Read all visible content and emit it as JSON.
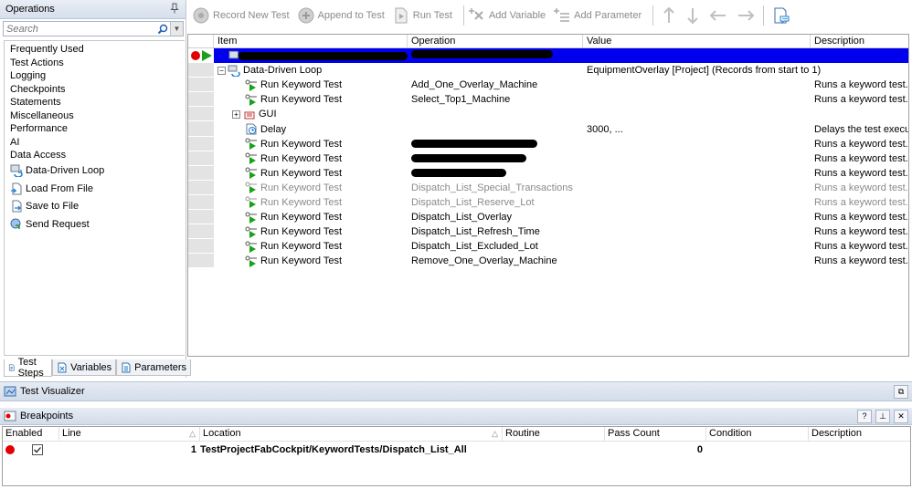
{
  "operations_panel": {
    "title": "Operations",
    "search_placeholder": "Search",
    "items": [
      "Frequently Used",
      "Test Actions",
      "Logging",
      "Checkpoints",
      "Statements",
      "Miscellaneous",
      "Performance",
      "AI",
      "Data Access"
    ],
    "icon_items": [
      {
        "label": "Data-Driven Loop",
        "icon": "loop-icon"
      },
      {
        "label": "Load From File",
        "icon": "load-file-icon"
      },
      {
        "label": "Save to File",
        "icon": "save-file-icon"
      },
      {
        "label": "Send Request",
        "icon": "send-request-icon"
      }
    ],
    "tabs": [
      "Test Steps",
      "Variables",
      "Parameters"
    ]
  },
  "toolbar": {
    "record_new_test": "Record New Test",
    "append_to_test": "Append to Test",
    "run_test": "Run Test",
    "add_variable": "Add Variable",
    "add_parameter": "Add Parameter"
  },
  "grid": {
    "columns": [
      "Item",
      "Operation",
      "Value",
      "Description"
    ],
    "rows": [
      {
        "item": "",
        "operation": "",
        "value": "",
        "description": "",
        "selected": true,
        "redacted_item": true
      },
      {
        "item": "Data-Driven Loop",
        "operation": "",
        "value": "EquipmentOverlay [Project] (Records from start to 1)",
        "description": ""
      },
      {
        "item": "Run Keyword Test",
        "operation": "Add_One_Overlay_Machine",
        "value": "",
        "description": "Runs a keyword test."
      },
      {
        "item": "Run Keyword Test",
        "operation": "Select_Top1_Machine",
        "value": "",
        "description": "Runs a keyword test."
      },
      {
        "item": "GUI",
        "operation": "",
        "value": "",
        "description": ""
      },
      {
        "item": "Delay",
        "operation": "",
        "value": "3000, ...",
        "description": "Delays the test execut..."
      },
      {
        "item": "Run Keyword Test",
        "operation": "",
        "value": "",
        "description": "Runs a keyword test.",
        "redacted_op": 138
      },
      {
        "item": "Run Keyword Test",
        "operation": "",
        "value": "",
        "description": "Runs a keyword test.",
        "redacted_op": 126
      },
      {
        "item": "Run Keyword Test",
        "operation": "",
        "value": "",
        "description": "Runs a keyword test.",
        "redacted_op": 104
      },
      {
        "item": "Run Keyword Test",
        "operation": "Dispatch_List_Special_Transactions",
        "value": "",
        "description": "Runs a keyword test.",
        "disabled": true
      },
      {
        "item": "Run Keyword Test",
        "operation": "Dispatch_List_Reserve_Lot",
        "value": "",
        "description": "Runs a keyword test.",
        "disabled": true
      },
      {
        "item": "Run Keyword Test",
        "operation": "Dispatch_List_Overlay",
        "value": "",
        "description": "Runs a keyword test."
      },
      {
        "item": "Run Keyword Test",
        "operation": "Dispatch_List_Refresh_Time",
        "value": "",
        "description": "Runs a keyword test."
      },
      {
        "item": "Run Keyword Test",
        "operation": "Dispatch_List_Excluded_Lot",
        "value": "",
        "description": "Runs a keyword test."
      },
      {
        "item": "Run Keyword Test",
        "operation": "Remove_One_Overlay_Machine",
        "value": "",
        "description": "Runs a keyword test."
      }
    ]
  },
  "visualizer": {
    "title": "Test Visualizer"
  },
  "breakpoints": {
    "title": "Breakpoints",
    "columns": [
      "Enabled",
      "Line",
      "Location",
      "Routine",
      "Pass Count",
      "Condition",
      "Description"
    ],
    "row": {
      "line": "1",
      "location": "TestProjectFabCockpit/KeywordTests/Dispatch_List_All",
      "routine": "",
      "pass_count": "0",
      "condition": "",
      "description": ""
    }
  },
  "colors": {
    "accent": "#0000ee",
    "run_green": "#1aa01a",
    "breakpoint_red": "#e00000"
  }
}
